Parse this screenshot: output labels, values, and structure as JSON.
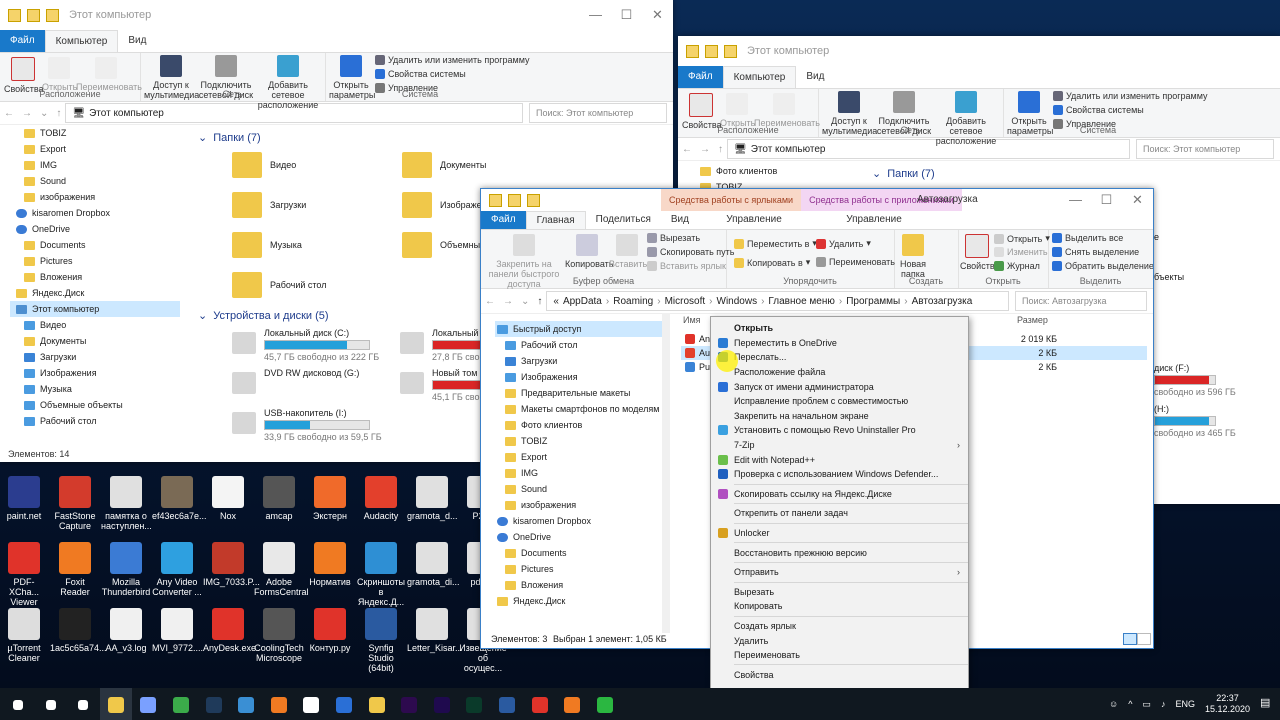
{
  "window1": {
    "title": "Этот компьютер",
    "tabs": [
      "Файл",
      "Компьютер",
      "Вид"
    ],
    "ribbon": {
      "properties": "Свойства",
      "open": "Открыть",
      "rename": "Переименовать",
      "group_location": "Расположение",
      "media_access": "Доступ к мультимедиа",
      "map_drive": "Подключить сетевой диск",
      "add_location": "Добавить сетевое расположение",
      "group_network": "Сеть",
      "open_params": "Открыть параметры",
      "uninstall": "Удалить или изменить программу",
      "sys_props": "Свойства системы",
      "manage": "Управление",
      "group_system": "Система"
    },
    "address": "Этот компьютер",
    "search_placeholder": "Поиск: Этот компьютер",
    "tree": [
      "TOBIZ",
      "Export",
      "IMG",
      "Sound",
      "изображения",
      "kisaromen Dropbox",
      "OneDrive",
      "Documents",
      "Pictures",
      "Вложения",
      "Яндекс.Диск",
      "Этот компьютер",
      "Видео",
      "Документы",
      "Загрузки",
      "Изображения",
      "Музыка",
      "Объемные объекты",
      "Рабочий стол"
    ],
    "folders_header": "Папки (7)",
    "folders": [
      "Видео",
      "Документы",
      "Загрузки",
      "Изображения",
      "Музыка",
      "Объемные объекты",
      "Рабочий стол"
    ],
    "drives_header": "Устройства и диски (5)",
    "drives": [
      {
        "name": "Локальный диск (C:)",
        "free": "45,7 ГБ свободно из 222 ГБ",
        "fill": 0.79
      },
      {
        "name": "Локальный диск (D:)",
        "free": "27,8 ГБ свободно из 222 ГБ",
        "fill": 0.88
      },
      {
        "name": "DVD RW дисковод (G:)",
        "free": "",
        "fill": 0
      },
      {
        "name": "Новый том (H:)",
        "free": "45,1 ГБ свободно из 465 ГБ",
        "fill": 0.9
      },
      {
        "name": "USB-накопитель (I:)",
        "free": "33,9 ГБ свободно из 59,5 ГБ",
        "fill": 0.43
      }
    ],
    "status": "Элементов: 14"
  },
  "window2": {
    "title": "Этот компьютер",
    "tabs": [
      "Файл",
      "Компьютер",
      "Вид"
    ],
    "address": "Этот компьютер",
    "search_placeholder": "Поиск: Этот компьютер",
    "tree_partial": [
      "Фото клиентов",
      "TOBIZ"
    ],
    "folders_header": "Папки (7)",
    "drive_partial_1": "диск (F:)",
    "drive_partial_1_free": "свободно из 596 ГБ",
    "drive_partial_2": "(H:)",
    "drive_partial_2_free": "свободно из 465 ГБ"
  },
  "window3": {
    "title": "Автозагрузка",
    "tool_tabs": [
      "Средства работы с ярлыками",
      "Средства работы с приложениями"
    ],
    "tabs": [
      "Файл",
      "Главная",
      "Поделиться",
      "Вид",
      "Управление",
      "Управление"
    ],
    "ribbon": {
      "pin": "Закрепить на панели быстрого доступа",
      "copy": "Копировать",
      "paste": "Вставить",
      "cut": "Вырезать",
      "copy_path": "Скопировать путь",
      "paste_shortcut": "Вставить ярлык",
      "group_clipboard": "Буфер обмена",
      "move_to": "Переместить в",
      "copy_to": "Копировать в",
      "delete": "Удалить",
      "rename": "Переименовать",
      "group_organize": "Упорядочить",
      "new_folder": "Новая папка",
      "group_create": "Создать",
      "properties": "Свойства",
      "open": "Открыть",
      "edit": "Изменить",
      "journal": "Журнал",
      "group_open": "Открыть",
      "select_all": "Выделить все",
      "select_none": "Снять выделение",
      "invert": "Обратить выделение",
      "group_select": "Выделить"
    },
    "breadcrumb": [
      "AppData",
      "Roaming",
      "Microsoft",
      "Windows",
      "Главное меню",
      "Программы",
      "Автозагрузка"
    ],
    "search_placeholder": "Поиск: Автозагрузка",
    "tree": [
      "Быстрый доступ",
      "Рабочий стол",
      "Загрузки",
      "Изображения",
      "Предварительные макеты",
      "Макеты смартфонов по моделям",
      "Фото клиентов",
      "TOBIZ",
      "Export",
      "IMG",
      "Sound",
      "изображения",
      "kisaromen Dropbox",
      "OneDrive",
      "Documents",
      "Pictures",
      "Вложения",
      "Яндекс.Диск"
    ],
    "col_name": "Имя",
    "col_size": "Размер",
    "files": [
      {
        "name": "Any",
        "size": "2 019 КБ"
      },
      {
        "name": "Aud",
        "size": "2 КБ"
      },
      {
        "name": "Pun",
        "size": "2 КБ"
      }
    ],
    "status_items": "Элементов: 3",
    "status_selected": "Выбран 1 элемент: 1,05 КБ"
  },
  "context_menu": {
    "items": [
      {
        "label": "Открыть",
        "bold": true,
        "icon": "",
        "sep_after": false,
        "arrow": false
      },
      {
        "label": "Переместить в OneDrive",
        "icon": "onedrive-icon",
        "color": "#2a7bd4",
        "sep_after": false,
        "arrow": false
      },
      {
        "label": "Переслать...",
        "icon": "share-icon",
        "color": "#1d6fb8",
        "sep_after": false,
        "arrow": false
      },
      {
        "label": "Расположение файла",
        "icon": "",
        "sep_after": false,
        "arrow": false
      },
      {
        "label": "Запуск от имени администратора",
        "icon": "shield-icon",
        "color": "#2a6fd6",
        "sep_after": false,
        "arrow": false
      },
      {
        "label": "Исправление проблем с совместимостью",
        "icon": "",
        "sep_after": false,
        "arrow": false
      },
      {
        "label": "Закрепить на начальном экране",
        "icon": "",
        "sep_after": false,
        "arrow": false
      },
      {
        "label": "Установить с помощью Revo Uninstaller Pro",
        "icon": "revo-icon",
        "color": "#3aa0e0",
        "sep_after": false,
        "arrow": false
      },
      {
        "label": "7-Zip",
        "icon": "",
        "sep_after": false,
        "arrow": true
      },
      {
        "label": "Edit with Notepad++",
        "icon": "notepad-icon",
        "color": "#6abf4b",
        "sep_after": false,
        "arrow": false
      },
      {
        "label": "Проверка с использованием Windows Defender...",
        "icon": "defender-icon",
        "color": "#1f5fbf",
        "sep_after": true,
        "arrow": false
      },
      {
        "label": "Скопировать ссылку на Яндекс.Диске",
        "icon": "yandex-disk-icon",
        "color": "#b04fc0",
        "sep_after": true,
        "arrow": false
      },
      {
        "label": "Открепить от панели задач",
        "icon": "",
        "sep_after": true,
        "arrow": false
      },
      {
        "label": "Unlocker",
        "icon": "unlocker-icon",
        "color": "#d8a020",
        "sep_after": true,
        "arrow": false
      },
      {
        "label": "Восстановить прежнюю версию",
        "icon": "",
        "sep_after": true,
        "arrow": false
      },
      {
        "label": "Отправить",
        "icon": "",
        "sep_after": true,
        "arrow": true
      },
      {
        "label": "Вырезать",
        "icon": "",
        "sep_after": false,
        "arrow": false
      },
      {
        "label": "Копировать",
        "icon": "",
        "sep_after": true,
        "arrow": false
      },
      {
        "label": "Создать ярлык",
        "icon": "",
        "sep_after": false,
        "arrow": false
      },
      {
        "label": "Удалить",
        "icon": "",
        "sep_after": false,
        "arrow": false
      },
      {
        "label": "Переименовать",
        "icon": "",
        "sep_after": true,
        "arrow": false
      },
      {
        "label": "Свойства",
        "icon": "",
        "sep_after": false,
        "arrow": false
      }
    ]
  },
  "desktop_icons": [
    {
      "label": "paint.net",
      "color": "#2b3d8f",
      "col": 0,
      "row": 0
    },
    {
      "label": "FastStone Capture",
      "color": "#d33b2c",
      "col": 1,
      "row": 0
    },
    {
      "label": "памятка о наступлен...",
      "color": "#e0e0e0",
      "col": 2,
      "row": 0
    },
    {
      "label": "ef43ec6a7e...",
      "color": "#7a6a55",
      "col": 3,
      "row": 0
    },
    {
      "label": "Nox",
      "color": "#f4f4f4",
      "col": 4,
      "row": 0
    },
    {
      "label": "amcap",
      "color": "#555555",
      "col": 5,
      "row": 0
    },
    {
      "label": "Экстерн",
      "color": "#f06a2a",
      "col": 6,
      "row": 0
    },
    {
      "label": "Audacity",
      "color": "#e3402c",
      "col": 7,
      "row": 0
    },
    {
      "label": "gramota_d...",
      "color": "#e0e0e0",
      "col": 8,
      "row": 0
    },
    {
      "label": "P260",
      "color": "#e0e0e0",
      "col": 9,
      "row": 0
    },
    {
      "label": "PDF-XCha... Viewer",
      "color": "#e0332a",
      "col": 0,
      "row": 1
    },
    {
      "label": "Foxit Reader",
      "color": "#f07a22",
      "col": 1,
      "row": 1
    },
    {
      "label": "Mozilla Thunderbird",
      "color": "#3b7bd4",
      "col": 2,
      "row": 1
    },
    {
      "label": "Any Video Converter ...",
      "color": "#2ea0e0",
      "col": 3,
      "row": 1
    },
    {
      "label": "IMG_7033.P...",
      "color": "#c23a2a",
      "col": 4,
      "row": 1
    },
    {
      "label": "Adobe FormsCentral",
      "color": "#e8e8e8",
      "col": 5,
      "row": 1
    },
    {
      "label": "Норматив",
      "color": "#f07a22",
      "col": 6,
      "row": 1
    },
    {
      "label": "Скриншоты в Яндекс.Д...",
      "color": "#2e8fd4",
      "col": 7,
      "row": 1
    },
    {
      "label": "gramota_di...",
      "color": "#e0e0e0",
      "col": 8,
      "row": 1
    },
    {
      "label": "pd202",
      "color": "#e0e0e0",
      "col": 9,
      "row": 1
    },
    {
      "label": "µTorrent Cleaner",
      "color": "#dddddd",
      "col": 0,
      "row": 2
    },
    {
      "label": "1ac5c65a74...",
      "color": "#222222",
      "col": 1,
      "row": 2
    },
    {
      "label": "AA_v3.log",
      "color": "#f0f0f0",
      "col": 2,
      "row": 2
    },
    {
      "label": "MVI_9772....",
      "color": "#f0f0f0",
      "col": 3,
      "row": 2
    },
    {
      "label": "AnyDesk.exe",
      "color": "#e0332a",
      "col": 4,
      "row": 2
    },
    {
      "label": "CoolingTech Microscope",
      "color": "#555555",
      "col": 5,
      "row": 2
    },
    {
      "label": "Контур.ру",
      "color": "#e0332a",
      "col": 6,
      "row": 2
    },
    {
      "label": "Synfig Studio (64bit)",
      "color": "#2a5aa0",
      "col": 7,
      "row": 2
    },
    {
      "label": "Letter_Kisar...",
      "color": "#e0e0e0",
      "col": 8,
      "row": 2
    },
    {
      "label": "Извещение об осущес...",
      "color": "#e0e0e0",
      "col": 9,
      "row": 2
    }
  ],
  "taskbar": {
    "apps": [
      {
        "name": "start-icon",
        "color": "#ffffff"
      },
      {
        "name": "search-icon",
        "color": "#ffffff"
      },
      {
        "name": "task-view-icon",
        "color": "#ffffff"
      },
      {
        "name": "explorer-icon",
        "color": "#f0c84a"
      },
      {
        "name": "app-icon",
        "color": "#7aa0ff"
      },
      {
        "name": "chrome-icon",
        "color": "#3bab4a"
      },
      {
        "name": "photoshop-icon",
        "color": "#1f3a5a"
      },
      {
        "name": "app-icon",
        "color": "#3a8fd4"
      },
      {
        "name": "firefox-icon",
        "color": "#f07a22"
      },
      {
        "name": "yandex-icon",
        "color": "#ffffff"
      },
      {
        "name": "app-icon",
        "color": "#2a6fd6"
      },
      {
        "name": "app-icon",
        "color": "#f0c84a"
      },
      {
        "name": "premiere-icon",
        "color": "#2d0a4e"
      },
      {
        "name": "after-effects-icon",
        "color": "#1f0a4e"
      },
      {
        "name": "audition-icon",
        "color": "#0a3a2a"
      },
      {
        "name": "visio-icon",
        "color": "#2a5aa0"
      },
      {
        "name": "app-icon",
        "color": "#e0332a"
      },
      {
        "name": "app-icon",
        "color": "#f07a22"
      },
      {
        "name": "whatsapp-icon",
        "color": "#2bb741"
      }
    ],
    "lang": "ENG",
    "time": "22:37",
    "date": "15.12.2020"
  }
}
